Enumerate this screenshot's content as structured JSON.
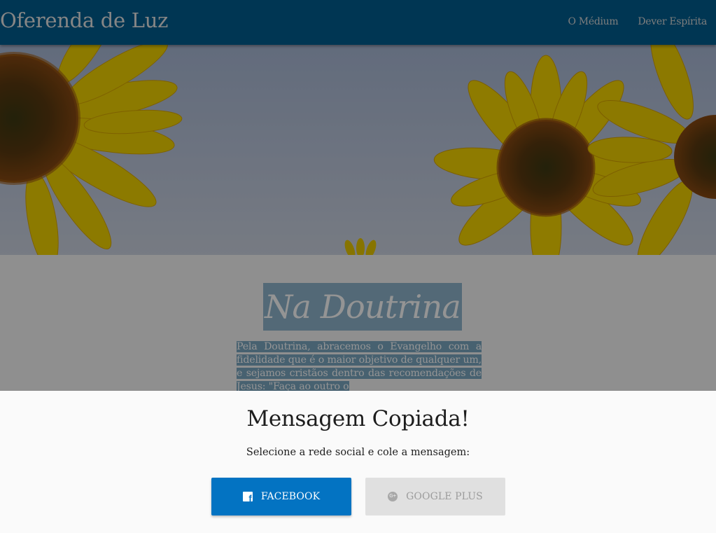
{
  "header": {
    "site_title": "Oferenda de Luz",
    "nav": [
      {
        "label": "O Médium"
      },
      {
        "label": "Dever Espírita"
      }
    ],
    "background_color": "#005e8f"
  },
  "hero": {
    "image_subject": "sunflowers against a pale blue sky"
  },
  "content": {
    "title": "Na Doutrina",
    "text": "Pela Doutrina, abracemos o Evangelho com a fidelidade que é o maior objetivo de qualquer um, e sejamos cristãos dentro das recomendações de Jesus: \"Faça ao outro o",
    "highlight_color": "#7ba7c2"
  },
  "modal": {
    "title": "Mensagem Copiada!",
    "subtitle": "Selecione a rede social e cole a mensagem:",
    "buttons": {
      "facebook_label": "FACEBOOK",
      "facebook_icon": "facebook-icon",
      "facebook_color": "#0373c2",
      "google_label": "GOOGLE PLUS",
      "google_icon": "google-plus-icon",
      "google_color": "#e0e0e0"
    }
  }
}
